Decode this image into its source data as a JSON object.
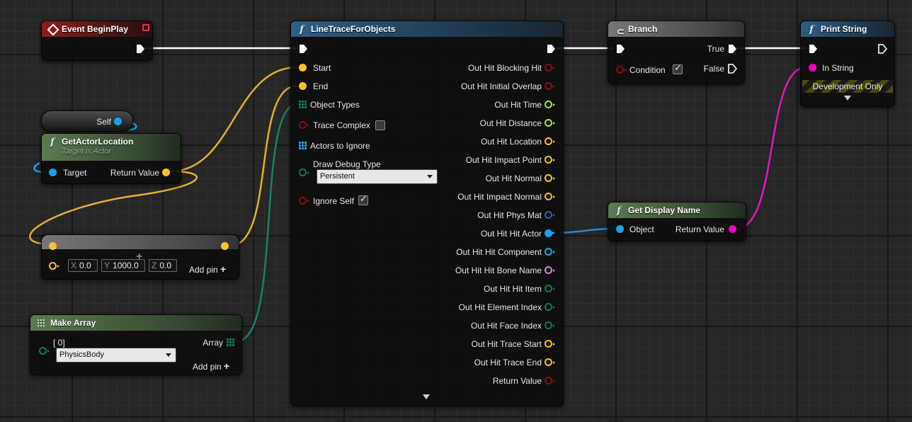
{
  "colors": {
    "exec": "#ffffff",
    "vector": "#fbc02d",
    "object": "#1aa3f0",
    "string": "#f000c8",
    "bool": "#8c0f0f",
    "float": "#9be84d",
    "enum": "#13785f",
    "name": "#c48ae5",
    "struct": "#2e5fb0"
  },
  "event_begin_play": {
    "title": "Event BeginPlay",
    "icon": "event-diamond-icon"
  },
  "self_node": {
    "label": "Self"
  },
  "get_actor_location": {
    "title": "GetActorLocation",
    "subtitle": "Target is Actor",
    "target": "Target",
    "return_value": "Return Value"
  },
  "add_vector": {
    "x_axis": "X",
    "x_value": "0.0",
    "y_axis": "Y",
    "y_value": "1000.0",
    "z_axis": "Z",
    "z_value": "0.0",
    "add_pin": "Add pin"
  },
  "make_array": {
    "title": "Make Array",
    "index": "[ 0]",
    "dropdown_value": "PhysicsBody",
    "array": "Array",
    "add_pin": "Add pin"
  },
  "line_trace": {
    "title": "LineTraceForObjects",
    "inputs": {
      "start": "Start",
      "end": "End",
      "object_types": "Object Types",
      "trace_complex": "Trace Complex",
      "actors_to_ignore": "Actors to Ignore",
      "draw_debug_type": "Draw Debug Type",
      "draw_debug_value": "Persistent",
      "ignore_self": "Ignore Self"
    },
    "outputs": [
      "Out Hit Blocking Hit",
      "Out Hit Initial Overlap",
      "Out Hit Time",
      "Out Hit Distance",
      "Out Hit Location",
      "Out Hit Impact Point",
      "Out Hit Normal",
      "Out Hit Impact Normal",
      "Out Hit Phys Mat",
      "Out Hit Hit Actor",
      "Out Hit Hit Component",
      "Out Hit Hit Bone Name",
      "Out Hit Hit Item",
      "Out Hit Element Index",
      "Out Hit Face Index",
      "Out Hit Trace Start",
      "Out Hit Trace End",
      "Return Value"
    ]
  },
  "branch": {
    "title": "Branch",
    "condition": "Condition",
    "true_label": "True",
    "false_label": "False"
  },
  "print_string": {
    "title": "Print String",
    "in_string": "In String",
    "dev_only": "Development Only"
  },
  "get_display_name": {
    "title": "Get Display Name",
    "object": "Object",
    "return_value": "Return Value"
  }
}
